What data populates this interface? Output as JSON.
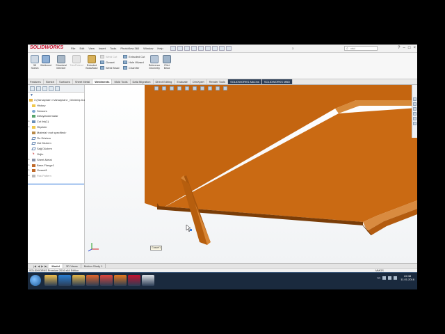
{
  "titlebar": {
    "logo": "SOLIDWORKS",
    "menu": [
      "File",
      "Edit",
      "View",
      "Insert",
      "Tools",
      "PhotoView 360",
      "Window",
      "Help"
    ],
    "doc_title": "3",
    "search_placeholder": "vrtd"
  },
  "ribbon": {
    "big_buttons": [
      {
        "label": "3D\nSketch"
      },
      {
        "label": "Weldment"
      },
      {
        "label": "Structural\nMember"
      },
      {
        "label": "Trim/Extend"
      },
      {
        "label": "Extruded\nBoss/Base"
      },
      {
        "label": "Reference\nGeometry"
      },
      {
        "label": "Fillet\nBead"
      }
    ],
    "small_buttons_col1": [
      {
        "label": "Weld Cut",
        "enabled": false
      },
      {
        "label": "Gusset",
        "enabled": true
      },
      {
        "label": "Weld Bead",
        "enabled": true
      }
    ],
    "small_buttons_col2": [
      {
        "label": "Extruded Cut",
        "enabled": true
      },
      {
        "label": "Hole Wizard",
        "enabled": true
      },
      {
        "label": "Chamfer",
        "enabled": true
      }
    ]
  },
  "cmd_tabs": [
    "Features",
    "Sketch",
    "Surfaces",
    "Sheet Metal",
    "Weldments",
    "Mold Tools",
    "Data Migration",
    "Direct Editing",
    "Evaluate",
    "DimXpert",
    "Render Tools",
    "SOLIDWORKS Add-Ins",
    "SOLIDWORKS MBD"
  ],
  "cmd_tab_active": "Weldments",
  "feature_tree": {
    "filter_icon": "filter-icon",
    "root": "3 (Varsayılan<<Varsayılan>_Görünüş Durumu 1>)",
    "items": [
      {
        "label": "History",
        "icon": "folder"
      },
      {
        "label": "Sensors",
        "icon": "sensor"
      },
      {
        "label": "Detaylandırmalar",
        "icon": "annot"
      },
      {
        "label": "Cut list(1)",
        "icon": "solid"
      },
      {
        "label": "Ölçekler",
        "icon": "folder"
      },
      {
        "label": "Material <not specified>",
        "icon": "mat"
      },
      {
        "label": "Ön Düzlem",
        "icon": "plane"
      },
      {
        "label": "Üst Düzlem",
        "icon": "plane"
      },
      {
        "label": "Sağ Düzlem",
        "icon": "plane"
      },
      {
        "label": "Orijin",
        "icon": "origin"
      },
      {
        "label": "Sheet-Metal",
        "icon": "sm"
      },
      {
        "label": "Base-Flange1",
        "icon": "feat"
      },
      {
        "label": "Gusset1",
        "icon": "feat"
      },
      {
        "label": "Flat-Pattern",
        "icon": "flat",
        "dim": true
      }
    ]
  },
  "viewport": {
    "tooltip": "Gusset1",
    "part_color": "#c86712"
  },
  "bottom_tabs": [
    "Model",
    "3D Views",
    "Motion Study 1"
  ],
  "bottom_tab_active": "Model",
  "status": {
    "text": "SOLIDWORKS Premium 2016 x64 Edition",
    "units": "MMGS"
  },
  "taskbar": {
    "apps": [
      {
        "name": "explorer",
        "color": "#f2c14e"
      },
      {
        "name": "ie",
        "color": "#2a7fd4"
      },
      {
        "name": "folder",
        "color": "#e8b94a"
      },
      {
        "name": "media",
        "color": "#e5662a"
      },
      {
        "name": "chrome",
        "color": "#e3453a"
      },
      {
        "name": "firefox",
        "color": "#e87a1e"
      },
      {
        "name": "solidworks",
        "color": "#c8102e"
      },
      {
        "name": "app",
        "color": "#dfe3e8"
      }
    ],
    "lang": "TR",
    "time": "22:48",
    "date": "11.01.2016"
  }
}
